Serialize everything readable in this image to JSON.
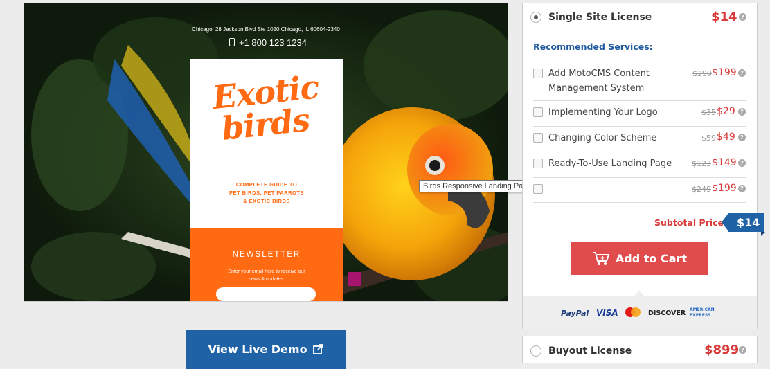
{
  "preview": {
    "address": "Chicago, 28 Jackson Blvd Ste 1020 Chicago, IL 60604-2340",
    "phone": "+1 800 123 1234",
    "title_line1": "Exotic",
    "title_line2": "birds",
    "subtitle_lines": [
      "COMPLETE GUIDE TO",
      "PET BIRDS, PET PARROTS",
      "& EXOTIC BIRDS"
    ],
    "newsletter_title": "NEWSLETTER",
    "newsletter_desc": "Enter your email here to receive our news & updates:",
    "accent_color": "#ff6a13"
  },
  "tooltip": "Birds Responsive Landing Page Template New Screenshots BIG",
  "demo": {
    "label": "View Live Demo"
  },
  "single_license": {
    "label": "Single Site License",
    "price": "$14",
    "selected": true
  },
  "recommended_title": "Recommended Services:",
  "services": [
    {
      "name": "Add MotoCMS Content Management System",
      "old_price": "$299",
      "price": "$199"
    },
    {
      "name": "Implementing Your Logo",
      "old_price": "$35",
      "price": "$29"
    },
    {
      "name": "Changing Color Scheme",
      "old_price": "$59",
      "price": "$49"
    },
    {
      "name": "Ready-To-Use Landing Page",
      "old_price": "$123",
      "price": "$149"
    },
    {
      "name": "",
      "old_price": "$249",
      "price": "$199"
    }
  ],
  "subtotal": {
    "label": "Subtotal Price:",
    "value": "$14"
  },
  "cart": {
    "label": "Add to Cart"
  },
  "payments": [
    "PayPal",
    "VISA",
    "MasterCard",
    "DISCOVER",
    "AMERICAN EXPRESS"
  ],
  "buyout_license": {
    "label": "Buyout License",
    "price": "$899"
  },
  "help_glyph": "?",
  "colors": {
    "price_red": "#d93a3a",
    "brand_blue": "#1f62a6",
    "cart_red": "#e04b4b"
  }
}
